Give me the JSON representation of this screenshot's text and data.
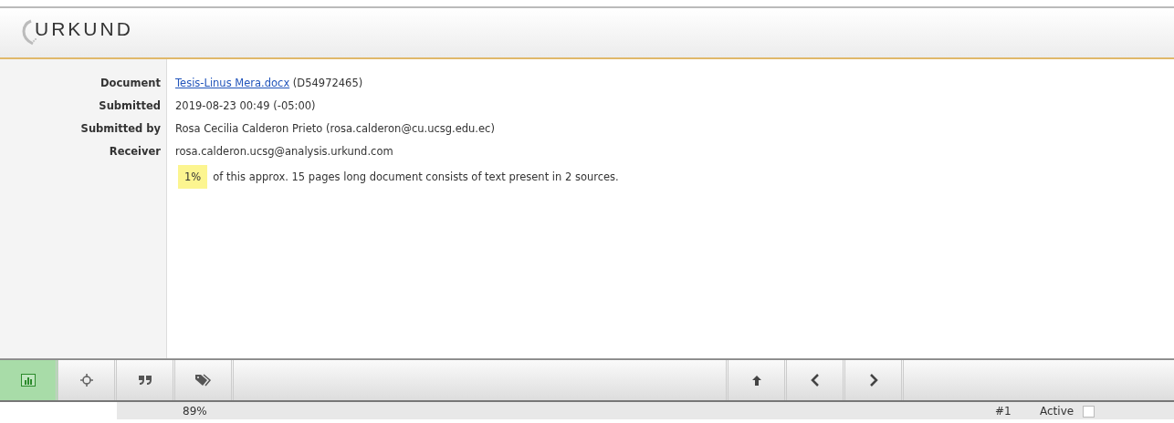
{
  "header": {
    "logo": "URKUND"
  },
  "details": [
    {
      "label": "Document",
      "kind": "link",
      "link": "Tesis-Linus Mera.docx",
      "value": "(D54972465)"
    },
    {
      "label": "Submitted",
      "kind": "text",
      "value": "2019-08-23 00:49 (-05:00)"
    },
    {
      "label": "Submitted by",
      "kind": "text",
      "value": "Rosa Cecilia Calderon Prieto (rosa.calderon@cu.ucsg.edu.ec)"
    },
    {
      "label": "Receiver",
      "kind": "text",
      "value": "rosa.calderon.ucsg@analysis.urkund.com"
    }
  ],
  "summary": {
    "percentage": "1%",
    "text": "of this approx. 15 pages long document consists of text present in 2 sources."
  },
  "toolbar": {
    "left": [
      {
        "kind": "chart",
        "selected": true
      },
      {
        "kind": "crosshair",
        "selected": false
      },
      {
        "kind": "quote",
        "selected": false
      },
      {
        "kind": "tags",
        "selected": false
      }
    ],
    "right": [
      {
        "kind": "up"
      },
      {
        "kind": "prev"
      },
      {
        "kind": "next"
      }
    ]
  },
  "status": {
    "zoom": "89%",
    "number": "#1",
    "active_label": "Active",
    "active": false
  }
}
